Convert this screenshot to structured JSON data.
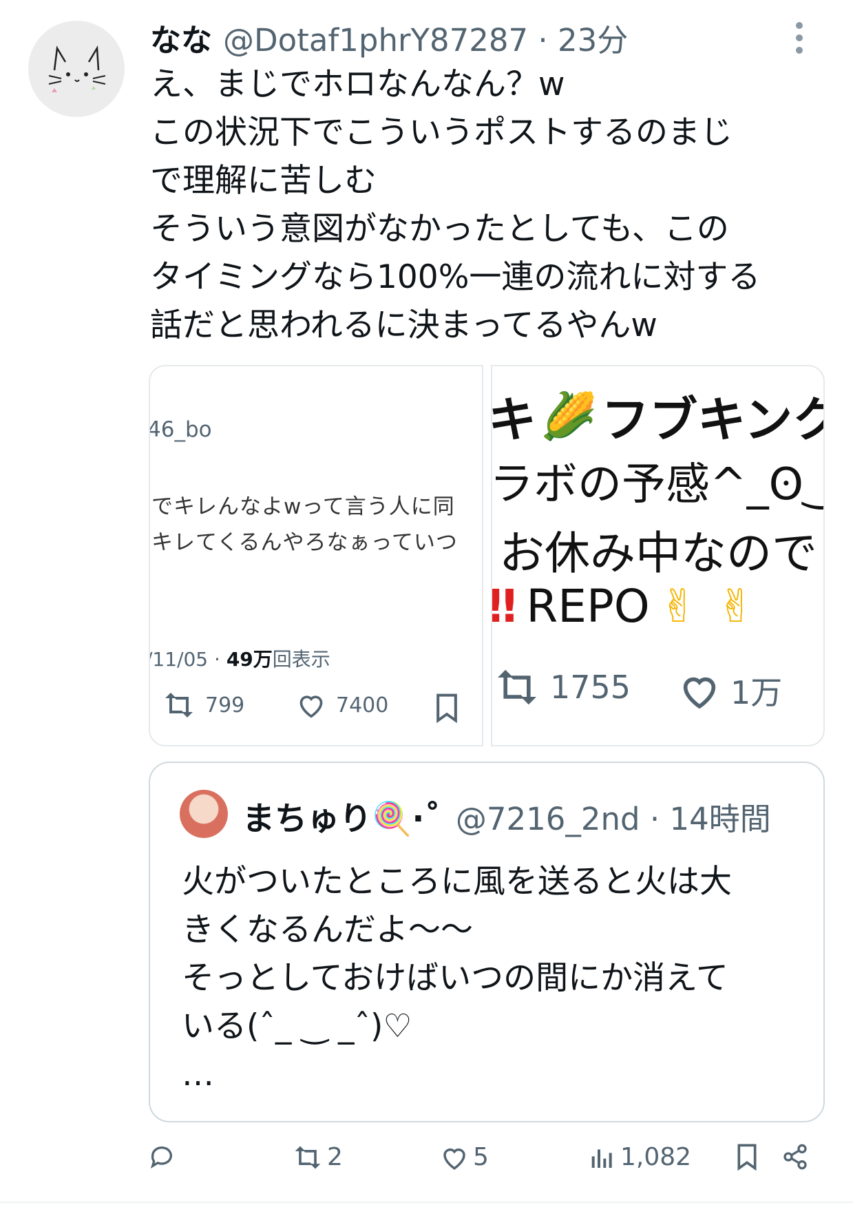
{
  "post": {
    "name": "なな",
    "handle_time": "@Dotaf1phrY87287 · 23分",
    "body": "え、まじでホロなんなん？w\nこの状況下でこういうポストするのまじ\nで理解に苦しむ\nそういう意図がなかったとしても、この\nタイミングなら100%一連の流れに対する\n話だと思われるに決まってるやんw"
  },
  "images": {
    "left": {
      "handle_fragment": "46_bo",
      "line1": "でキレんなよwって言う人に同",
      "line2": "キレてくるんやろなぁっていつ",
      "meta_date": "/11/05 · ",
      "meta_views_num": "49万",
      "meta_views_label": "回表示",
      "retweets": "799",
      "likes": "7400"
    },
    "right": {
      "line1_a": "キ",
      "line1_b": "フブキンク",
      "line2": "ラボの予感^_ʘ‿ʘ",
      "line3": "お休み中なので",
      "line4_a": "‼",
      "line4_b": "REPO",
      "emoji_peace": "✌",
      "emoji_corn": "🌽",
      "retweets": "1755",
      "likes": "1万"
    }
  },
  "quote": {
    "name": "まちゅり🍭·˚",
    "handle_time": "@7216_2nd · 14時間",
    "body": "火がついたところに風を送ると火は大\nきくなるんだよ〜〜\nそっとしておけばいつの間にか消えて\nいる(ˆ_ ‿ _ˆ)♡\n…"
  },
  "actions": {
    "replies": "",
    "reposts": "2",
    "likes": "5",
    "views": "1,082"
  },
  "icons": [
    "more-icon",
    "reply-icon",
    "repost-icon",
    "like-icon",
    "views-icon",
    "bookmark-icon",
    "share-icon"
  ]
}
